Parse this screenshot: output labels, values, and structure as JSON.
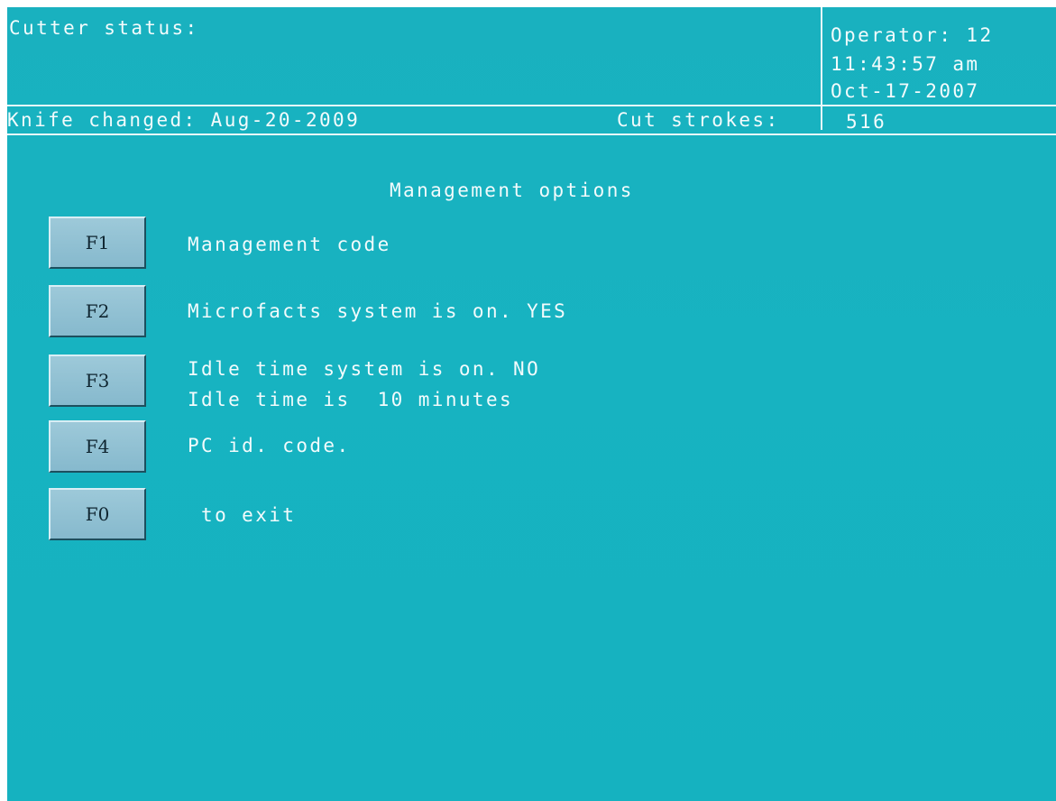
{
  "header": {
    "cutter_status_label": "Cutter status:",
    "operator": "Operator: 12",
    "time": "11:43:57 am",
    "date": "Oct-17-2007",
    "knife_changed": "Knife changed: Aug-20-2009",
    "cut_strokes_label": "Cut strokes:",
    "cut_strokes_value": "516"
  },
  "main": {
    "title": "Management options",
    "options": [
      {
        "key": "F1",
        "lines": [
          "Management code"
        ]
      },
      {
        "key": "F2",
        "lines": [
          "Microfacts system is on. YES"
        ]
      },
      {
        "key": "F3",
        "lines": [
          "Idle time system is on. NO",
          "Idle time is  10 minutes"
        ]
      },
      {
        "key": "F4",
        "lines": [
          "PC id. code."
        ]
      },
      {
        "key": "F0",
        "lines": [
          " to exit"
        ]
      }
    ]
  },
  "colors": {
    "background": "#17b3c1",
    "text": "#f2fbfc",
    "key_face": "#93c2d4"
  }
}
